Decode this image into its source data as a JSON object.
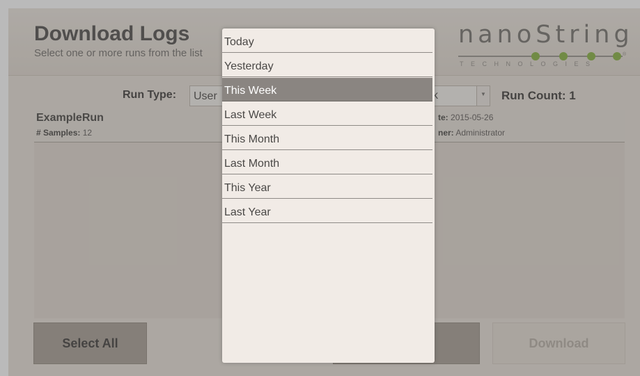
{
  "header": {
    "title": "Download Logs",
    "subtitle": "Select one or more runs from the list"
  },
  "logo": {
    "word": "nanoString",
    "sub": "TECHNOLOGIES",
    "accent_color": "#9cbf5f"
  },
  "filters": {
    "run_type_label": "Run Type:",
    "run_type_value": "User",
    "date_value": "k",
    "run_count_label": "Run Count: 1"
  },
  "runs": [
    {
      "name": "ExampleRun",
      "samples_label": "# Samples:",
      "samples": "12",
      "date_label": "te:",
      "date": "2015-05-26",
      "owner_label": "ner:",
      "owner": "Administrator"
    }
  ],
  "buttons": {
    "select_all": "Select All",
    "download": "Download"
  },
  "dropdown": {
    "selected_index": 2,
    "items": [
      "Today",
      "Yesterday",
      "This Week",
      "Last Week",
      "This Month",
      "Last Month",
      "This Year",
      "Last Year"
    ]
  }
}
